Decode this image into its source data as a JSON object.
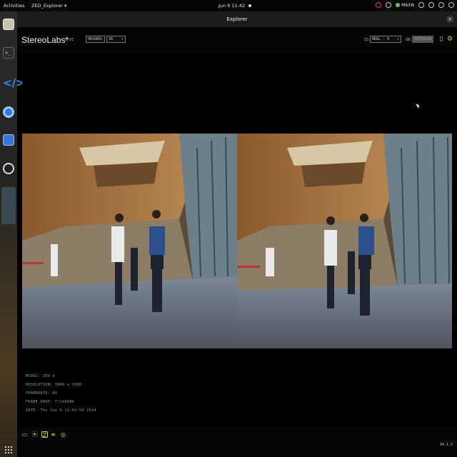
{
  "topbar": {
    "activities": "Activities",
    "app_menu": "ZED_Explorer ▾",
    "clock": "Jun 6  11:42",
    "power_mode": "MAXN"
  },
  "window": {
    "title": "Explorer",
    "close": "×"
  },
  "app": {
    "brand": "StereoLabs*",
    "status": "LIVE",
    "resolution_value": "HD1080",
    "framerate_value": "30",
    "is_label": "IS:",
    "is_value": "BRGL - 0",
    "gain_label": "GN:",
    "gain_value": "AUTOGAIN"
  },
  "info": {
    "model": "MODEL: ZED X",
    "resolution": "RESOLUTION: 3840 x 1080",
    "framerate": "FRAMERATE: 60",
    "frame_drop": "FRAME DROP: 7/140884",
    "date": "DATE: Thu Jun 6 11:42:54 2024"
  },
  "footer": {
    "version": "V4.1.2"
  },
  "icons": {
    "folder": "folder-icon",
    "record": "record-icon",
    "zed": "zed-camera-icon",
    "mode": "mode-icon",
    "snapshot": "snapshot-icon",
    "settings": "settings-icon"
  },
  "colors": {
    "accent": "#d8d048",
    "background": "#000000"
  }
}
